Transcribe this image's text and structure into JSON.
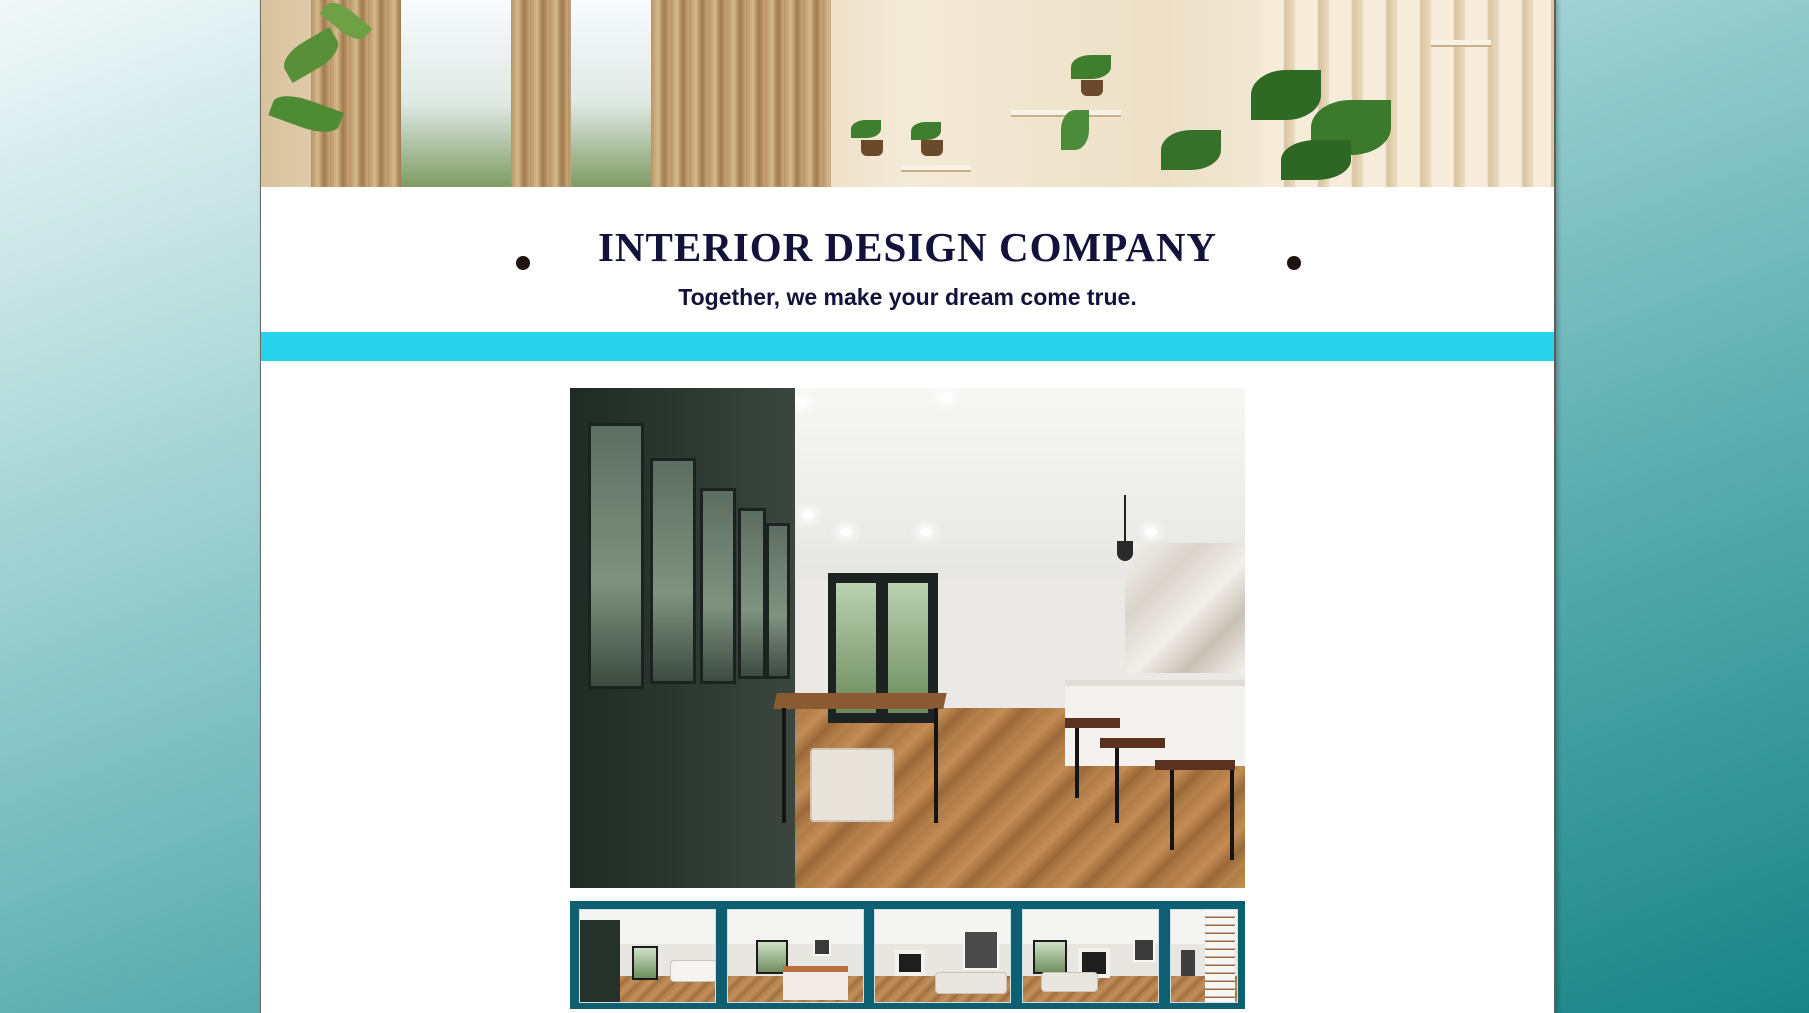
{
  "header": {
    "title": "INTERIOR DESIGN COMPANY",
    "tagline": "Together, we make your dream come true."
  },
  "colors": {
    "accent_bar": "#27d3ea",
    "title_text": "#12123a",
    "thumbnail_strip": "#0f5f72",
    "page_background": "#ffffff"
  },
  "gallery": {
    "thumbnails": [
      {
        "name": "dining-kitchen-thumbnail"
      },
      {
        "name": "bedroom-thumbnail"
      },
      {
        "name": "living-room-art-thumbnail"
      },
      {
        "name": "living-room-fireplace-thumbnail"
      },
      {
        "name": "staircase-thumbnail"
      }
    ]
  }
}
